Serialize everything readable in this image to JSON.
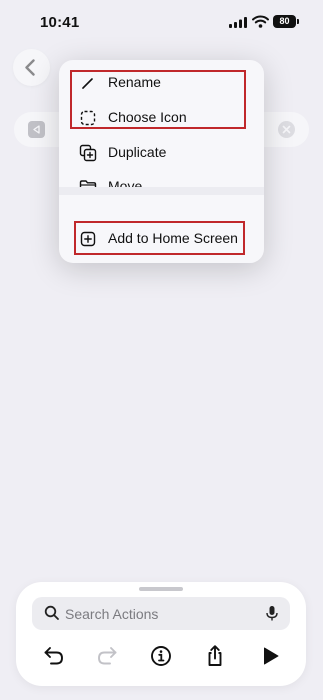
{
  "status_bar": {
    "time": "10:41",
    "battery": "80"
  },
  "menu": {
    "items": [
      {
        "label": "Rename",
        "icon": "pencil-icon"
      },
      {
        "label": "Choose Icon",
        "icon": "dashed-square-icon"
      },
      {
        "label": "Duplicate",
        "icon": "duplicate-icon"
      },
      {
        "label": "Move",
        "icon": "folder-icon"
      },
      {
        "label": "Add to Home Screen",
        "icon": "add-square-icon"
      }
    ]
  },
  "bottom_sheet": {
    "search_placeholder": "Search Actions",
    "toolbar": [
      "undo-icon",
      "redo-icon",
      "info-icon",
      "share-icon",
      "play-icon"
    ]
  },
  "colors": {
    "highlight": "#c0282b",
    "background": "#efeef4"
  }
}
